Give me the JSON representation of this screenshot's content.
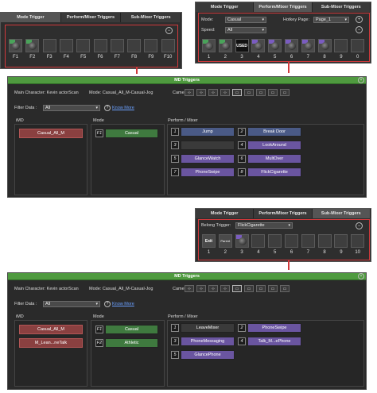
{
  "mode_panel": {
    "tabs": [
      "Mode Trigger",
      "Perform/Mixer Triggers",
      "Sub-Mixer Triggers"
    ],
    "slots": [
      "F1",
      "F2",
      "F3",
      "F4",
      "F5",
      "F6",
      "F7",
      "F8",
      "F9",
      "F10"
    ]
  },
  "perform_panel": {
    "tabs": [
      "Mode Trigger",
      "Perform/Mixer Triggers",
      "Sub-Mixer Triggers"
    ],
    "mode_label": "Mode:",
    "mode_value": "Casual",
    "hotkey_label": "Hotkey Page:",
    "hotkey_value": "Page_1",
    "speed_label": "Speed:",
    "speed_value": "All",
    "used_label": "USED",
    "slots": [
      "1",
      "2",
      "3",
      "4",
      "5",
      "6",
      "7",
      "8",
      "9",
      "0"
    ]
  },
  "md1": {
    "title": "MD Triggers",
    "character": "Main Character: Kevin actorScan",
    "mode": "Mode: Casual_All_M-Casual-Jog",
    "camera_label": "Camera:",
    "filter_label": "Filter Data :",
    "filter_value": "All",
    "know_more": "Know More",
    "imd_header": "iMD",
    "mode_header": "Mode",
    "perform_header": "Perform / Mixer",
    "imd_items": [
      "Casual_All_M"
    ],
    "mode_items": [
      {
        "key": "F1",
        "label": "Casual"
      }
    ],
    "perform_items": [
      {
        "key": "1",
        "label": "Jump"
      },
      {
        "key": "2",
        "label": "Break Door"
      },
      {
        "key": "3",
        "label": ""
      },
      {
        "key": "4",
        "label": "LookAround"
      },
      {
        "key": "5",
        "label": "GlanceWatch"
      },
      {
        "key": "6",
        "label": "MultOver"
      },
      {
        "key": "7",
        "label": "PhoneSwipe"
      },
      {
        "key": "8",
        "label": "FlickCigarette"
      }
    ]
  },
  "submixer_panel": {
    "tabs": [
      "Mode Trigger",
      "Perform/Mixer Triggers",
      "Sub-Mixer Triggers"
    ],
    "belong_label": "Belong Trigger:",
    "belong_value": "FlickCigarette",
    "exit_label": "Exit",
    "parent_label": "Parent",
    "slots": [
      "1",
      "2",
      "3",
      "4",
      "5",
      "6",
      "7",
      "8",
      "9",
      "10"
    ]
  },
  "md2": {
    "title": "MD Triggers",
    "character": "Main Character: Kevin actorScan",
    "mode": "Mode: Casual_All_M-Casual-Jog",
    "camera_label": "Camera:",
    "filter_label": "Filter Data :",
    "filter_value": "All",
    "know_more": "Know More",
    "imd_header": "iMD",
    "mode_header": "Mode",
    "perform_header": "Perform / Mixer",
    "imd_items": [
      "Casual_All_M",
      "M_Lean...neTalk"
    ],
    "mode_items": [
      {
        "key": "F1",
        "label": "Casual"
      },
      {
        "key": "F2",
        "label": "Athletic"
      }
    ],
    "perform_items": [
      {
        "key": "1",
        "label": "LeaveMixer"
      },
      {
        "key": "2",
        "label": "PhoneSwipe"
      },
      {
        "key": "3",
        "label": "PhoneMessaging"
      },
      {
        "key": "4",
        "label": "Talk_M...ePhone"
      },
      {
        "key": "5",
        "label": "GlancePhone"
      }
    ]
  },
  "colors": {
    "highlight": "#d0393b",
    "md_header": "#4f9a3f",
    "link": "#6aa0ff"
  }
}
